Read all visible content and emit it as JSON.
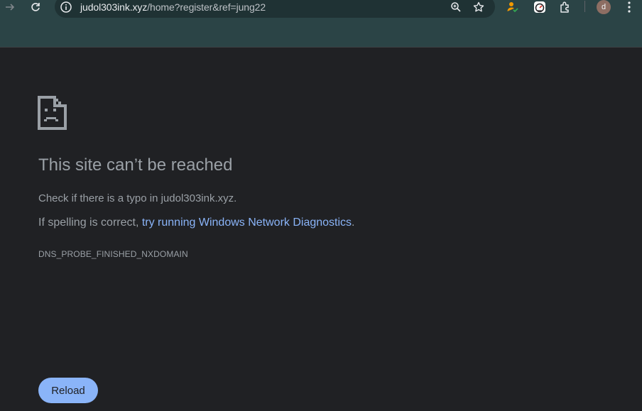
{
  "browser": {
    "address_bar": {
      "url_host": "judol303ink.xyz",
      "url_path": "/home?register&ref=jung22"
    },
    "icons": {
      "forward": "arrow-forward-icon",
      "reload": "reload-icon",
      "site_info": "site-info-icon",
      "zoom": "zoom-icon",
      "bookmark": "star-icon",
      "extension1": "person-check-icon",
      "extension2": "speedometer-icon",
      "extensions": "puzzle-icon",
      "menu": "more-vert-icon"
    },
    "profile_initial": "d",
    "colors": {
      "frame": "#2b4446",
      "omnibox": "#1f3234",
      "page_bg": "#202124",
      "link": "#8ab4f8",
      "button_bg": "#8ab4f8"
    }
  },
  "error_page": {
    "icon": "sad-page-icon",
    "title": "This site can’t be reached",
    "line1": "Check if there is a typo in judol303ink.xyz.",
    "line2_prefix": "If spelling is correct, ",
    "line2_link": "try running Windows Network Diagnostics",
    "line2_suffix": ".",
    "error_code": "DNS_PROBE_FINISHED_NXDOMAIN",
    "reload_button": "Reload"
  }
}
